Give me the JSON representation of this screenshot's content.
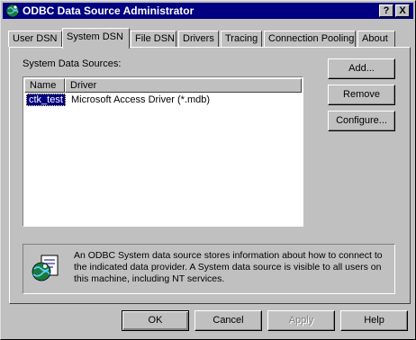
{
  "window": {
    "title": "ODBC Data Source Administrator",
    "help_button": "?",
    "close_button": "X"
  },
  "tabs": [
    {
      "label": "User DSN",
      "active": false
    },
    {
      "label": "System DSN",
      "active": true
    },
    {
      "label": "File DSN",
      "active": false
    },
    {
      "label": "Drivers",
      "active": false
    },
    {
      "label": "Tracing",
      "active": false
    },
    {
      "label": "Connection Pooling",
      "active": false
    },
    {
      "label": "About",
      "active": false
    }
  ],
  "system_dsn": {
    "list_label": "System Data Sources:",
    "columns": [
      "Name",
      "Driver"
    ],
    "rows": [
      {
        "name": "ctk_test",
        "driver": "Microsoft Access Driver (*.mdb)"
      }
    ],
    "buttons": {
      "add": "Add...",
      "remove": "Remove",
      "configure": "Configure..."
    },
    "info_text": "An ODBC System data source stores information about how to connect to the indicated data provider.  A System data source is visible to all users on this machine, including NT services."
  },
  "footer": {
    "ok": "OK",
    "cancel": "Cancel",
    "apply": "Apply",
    "help": "Help"
  },
  "icons": {
    "title": "odbc-globe-icon",
    "info": "odbc-globe-document-icon"
  }
}
